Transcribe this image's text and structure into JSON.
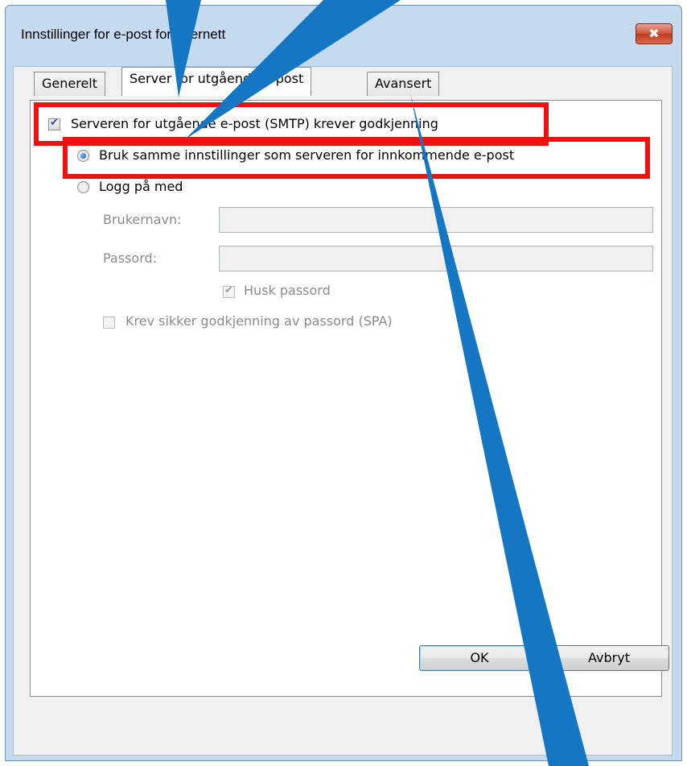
{
  "window": {
    "title": "Innstillinger for e-post for Internett",
    "close_glyph": "✖"
  },
  "tabs": [
    {
      "label": "Generelt"
    },
    {
      "label": "Server for utgående e-post"
    },
    {
      "label": "Avansert"
    }
  ],
  "smtp": {
    "require_auth_label": "Serveren for utgående e-post (SMTP) krever godkjenning",
    "checked": true
  },
  "auth_options": {
    "same_settings_label": "Bruk samme innstillinger som serveren for innkommende e-post",
    "logon_label": "Logg på med",
    "selected": "same_settings"
  },
  "logon": {
    "username_label": "Brukernavn:",
    "username_value": "",
    "password_label": "Passord:",
    "password_value": "",
    "remember_label": "Husk passord",
    "remember_checked": true,
    "spa_label": "Krev sikker godkjenning av passord (SPA)",
    "spa_checked": false
  },
  "buttons": {
    "ok": "OK",
    "cancel": "Avbryt"
  },
  "colors": {
    "highlight": "#ee1111",
    "arrow": "#1576c4",
    "window_frame": "#c5d9ef"
  }
}
